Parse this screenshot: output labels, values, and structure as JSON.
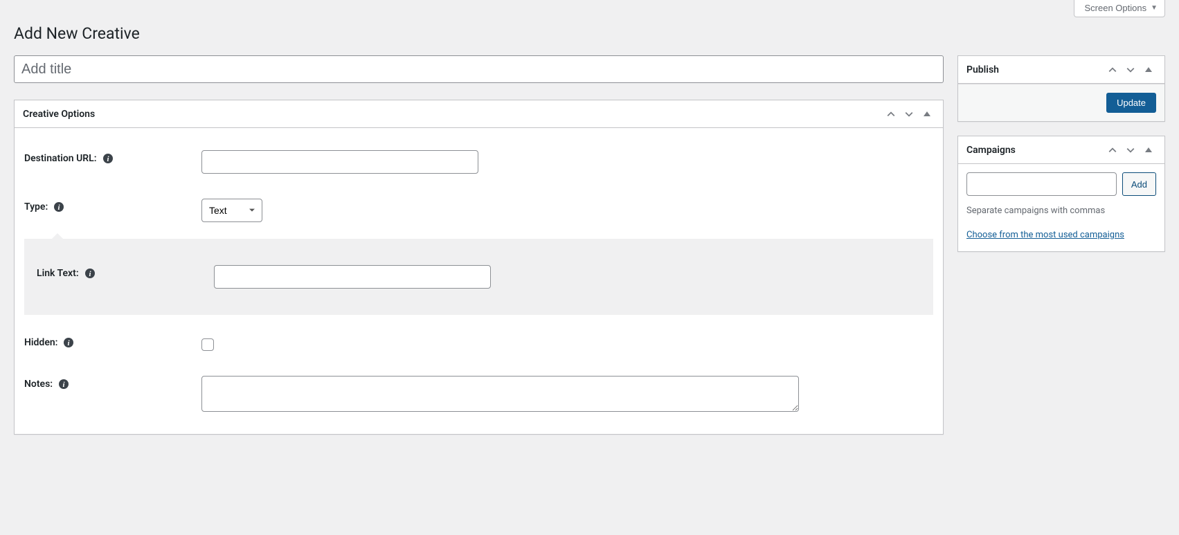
{
  "screen_options_label": "Screen Options",
  "page_title": "Add New Creative",
  "title_placeholder": "Add title",
  "creative_options": {
    "heading": "Creative Options",
    "destination_url_label": "Destination URL:",
    "type_label": "Type:",
    "type_value": "Text",
    "link_text_label": "Link Text:",
    "hidden_label": "Hidden:",
    "notes_label": "Notes:"
  },
  "publish": {
    "heading": "Publish",
    "update_button": "Update"
  },
  "campaigns": {
    "heading": "Campaigns",
    "add_button": "Add",
    "help_text": "Separate campaigns with commas",
    "choose_link": "Choose from the most used campaigns"
  }
}
